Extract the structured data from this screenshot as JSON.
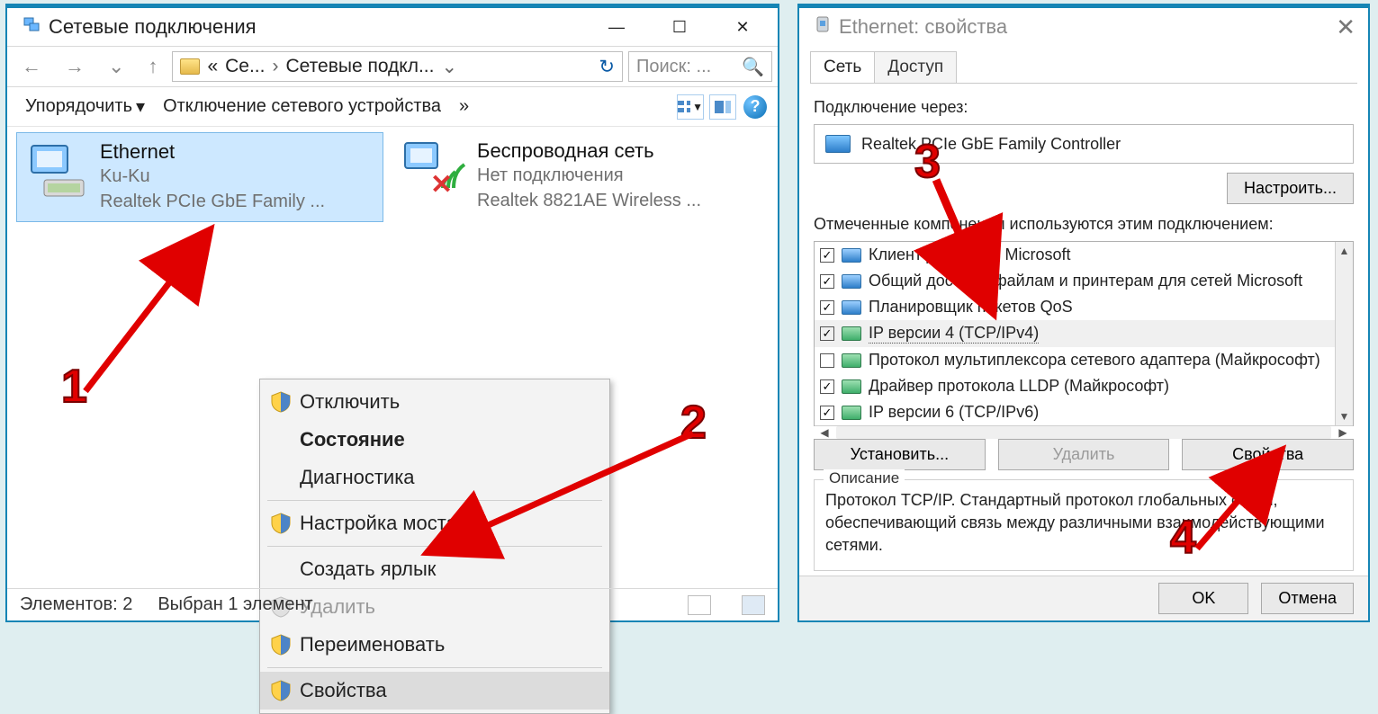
{
  "window1": {
    "title": "Сетевые подключения",
    "breadcrumb": {
      "short": "Се...",
      "current": "Сетевые подкл..."
    },
    "search_placeholder": "Поиск: ...",
    "toolbar": {
      "organize": "Упорядочить",
      "disable": "Отключение сетевого устройства"
    },
    "connections": [
      {
        "name": "Ethernet",
        "status": "Ku-Ku",
        "adapter": "Realtek PCIe GbE Family ..."
      },
      {
        "name": "Беспроводная сеть",
        "status": "Нет подключения",
        "adapter": "Realtek 8821AE Wireless ..."
      }
    ],
    "context_menu": {
      "disable": "Отключить",
      "status": "Состояние",
      "diag": "Диагностика",
      "bridge": "Настройка моста",
      "shortcut": "Создать ярлык",
      "delete": "Удалить",
      "rename": "Переименовать",
      "properties": "Свойства"
    },
    "statusbar": {
      "elements": "Элементов: 2",
      "selected": "Выбран 1 элемент"
    }
  },
  "window2": {
    "title": "Ethernet: свойства",
    "tabs": {
      "net": "Сеть",
      "access": "Доступ"
    },
    "connect_via_label": "Подключение через:",
    "adapter_name": "Realtek PCIe GbE Family Controller",
    "configure_btn": "Настроить...",
    "components_label": "Отмеченные компоненты используются этим подключением:",
    "components": [
      {
        "checked": true,
        "icon": "mon",
        "label": "Клиент для сетей Microsoft"
      },
      {
        "checked": true,
        "icon": "mon",
        "label": "Общий доступ к файлам и принтерам для сетей Microsoft"
      },
      {
        "checked": true,
        "icon": "mon",
        "label": "Планировщик пакетов QoS"
      },
      {
        "checked": true,
        "icon": "nic",
        "label": "IP версии 4 (TCP/IPv4)"
      },
      {
        "checked": false,
        "icon": "nic",
        "label": "Протокол мультиплексора сетевого адаптера (Майкрософт)"
      },
      {
        "checked": true,
        "icon": "nic",
        "label": "Драйвер протокола LLDP (Майкрософт)"
      },
      {
        "checked": true,
        "icon": "nic",
        "label": "IP версии 6 (TCP/IPv6)"
      }
    ],
    "buttons": {
      "install": "Установить...",
      "remove": "Удалить",
      "properties": "Свойства"
    },
    "description_label": "Описание",
    "description_text": "Протокол TCP/IP. Стандартный протокол глобальных сетей, обеспечивающий связь между различными взаимодействующими сетями.",
    "ok": "OK",
    "cancel": "Отмена"
  },
  "annotations": {
    "n1": "1",
    "n2": "2",
    "n3": "3",
    "n4": "4"
  }
}
